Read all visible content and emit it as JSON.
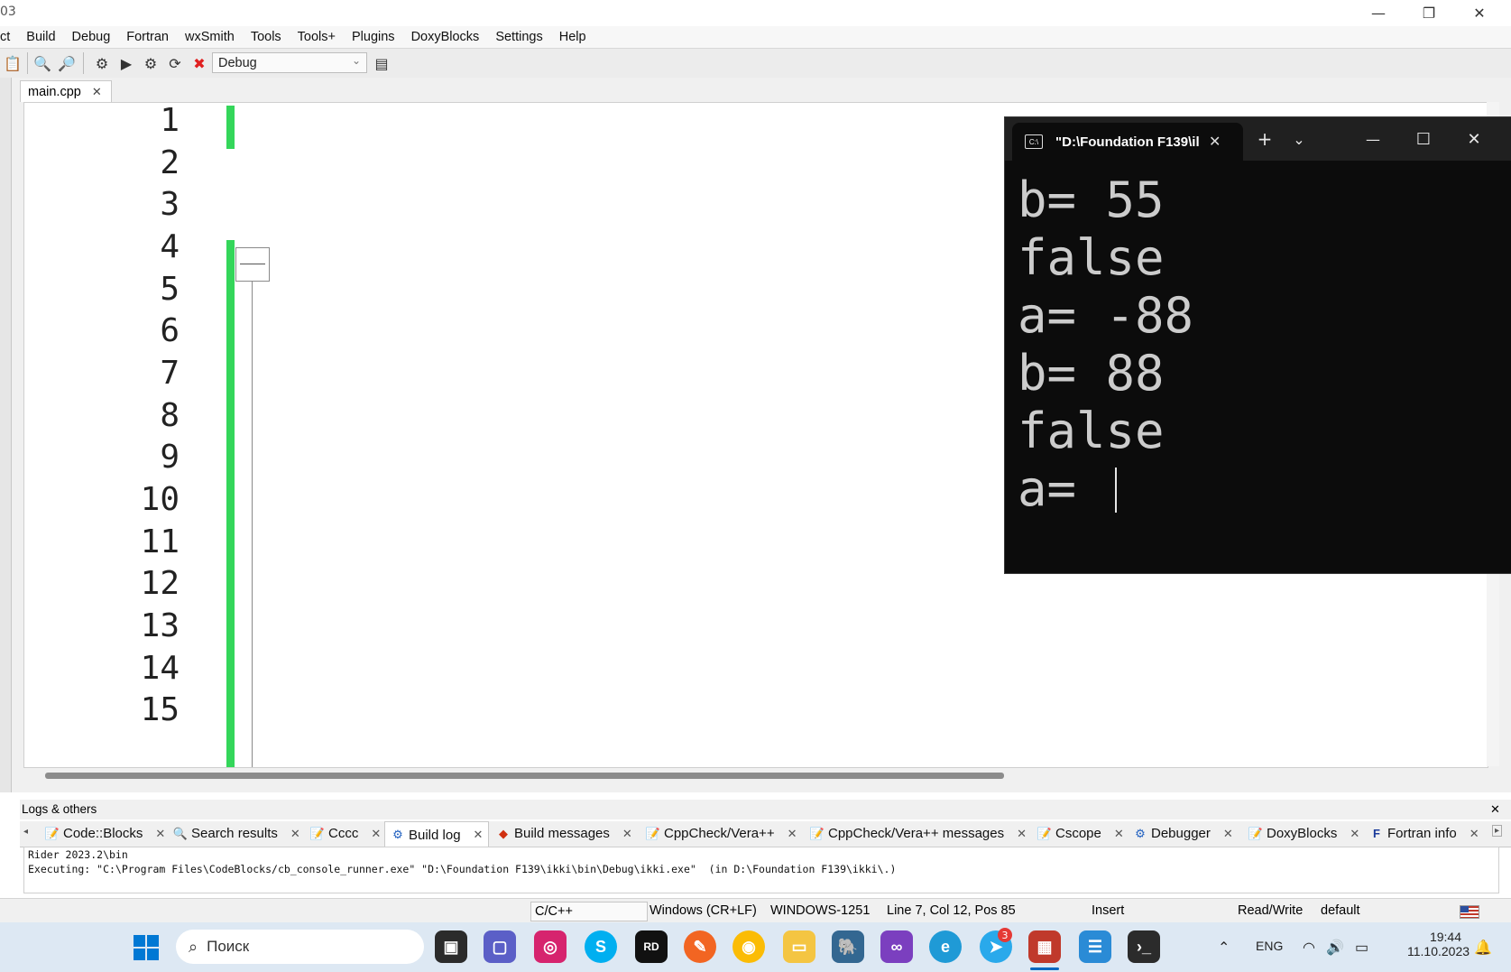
{
  "window": {
    "title_fragment": "03",
    "minimize": "—",
    "restore": "❐",
    "close": "✕"
  },
  "menu": [
    "ct",
    "Build",
    "Debug",
    "Fortran",
    "wxSmith",
    "Tools",
    "Tools+",
    "Plugins",
    "DoxyBlocks",
    "Settings",
    "Help"
  ],
  "toolbar": {
    "build_target": "Debug"
  },
  "editor": {
    "tab_label": "main.cpp",
    "tab_close": "✕",
    "line_numbers": [
      "1",
      "2",
      "3",
      "4",
      "5",
      "6",
      "7",
      "8",
      "9",
      "10",
      "11",
      "12",
      "13",
      "14",
      "15"
    ]
  },
  "console": {
    "tab_title": "\"D:\\Foundation F139\\il",
    "tab_close": "✕",
    "new_tab": "+",
    "dropdown": "⌄",
    "minimize": "—",
    "maximize": "☐",
    "close": "✕",
    "lines": [
      "b= 55",
      "false",
      "a= -88",
      "b= 88",
      "false",
      "a= "
    ]
  },
  "logs": {
    "title": "Logs & others",
    "close": "✕",
    "tabs": [
      {
        "label": "Code::Blocks",
        "icon": "document-icon"
      },
      {
        "label": "Search results",
        "icon": "magnifier-icon"
      },
      {
        "label": "Cccc",
        "icon": "document-icon"
      },
      {
        "label": "Build log",
        "icon": "gear-icon"
      },
      {
        "label": "Build messages",
        "icon": "diamond-icon"
      },
      {
        "label": "CppCheck/Vera++",
        "icon": "document-icon"
      },
      {
        "label": "CppCheck/Vera++ messages",
        "icon": "document-icon"
      },
      {
        "label": "Cscope",
        "icon": "document-icon"
      },
      {
        "label": "Debugger",
        "icon": "gear-icon"
      },
      {
        "label": "DoxyBlocks",
        "icon": "document-icon"
      },
      {
        "label": "Fortran info",
        "icon": "fortran-icon"
      }
    ],
    "lines": [
      "Rider 2023.2\\bin",
      "Executing: \"C:\\Program Files\\CodeBlocks/cb_console_runner.exe\" \"D:\\Foundation F139\\ikki\\bin\\Debug\\ikki.exe\"  (in D:\\Foundation F139\\ikki\\.)"
    ]
  },
  "status": {
    "language": "C/C++",
    "eol": "Windows (CR+LF)",
    "encoding": "WINDOWS-1251",
    "position": "Line 7, Col 12, Pos 85",
    "mode": "Insert",
    "access": "Read/Write",
    "profile": "default"
  },
  "taskbar": {
    "search_placeholder": "Поиск",
    "telegram_badge": "3",
    "language": "ENG",
    "time": "19:44",
    "date": "11.10.2023"
  },
  "colors": {
    "keyword": "#00008b",
    "green_keyword": "#008000",
    "operator": "#ff0000",
    "string": "#0000ff",
    "number": "#ff00ff",
    "change_bar": "#34d65a",
    "console_bg": "#0c0c0c"
  }
}
